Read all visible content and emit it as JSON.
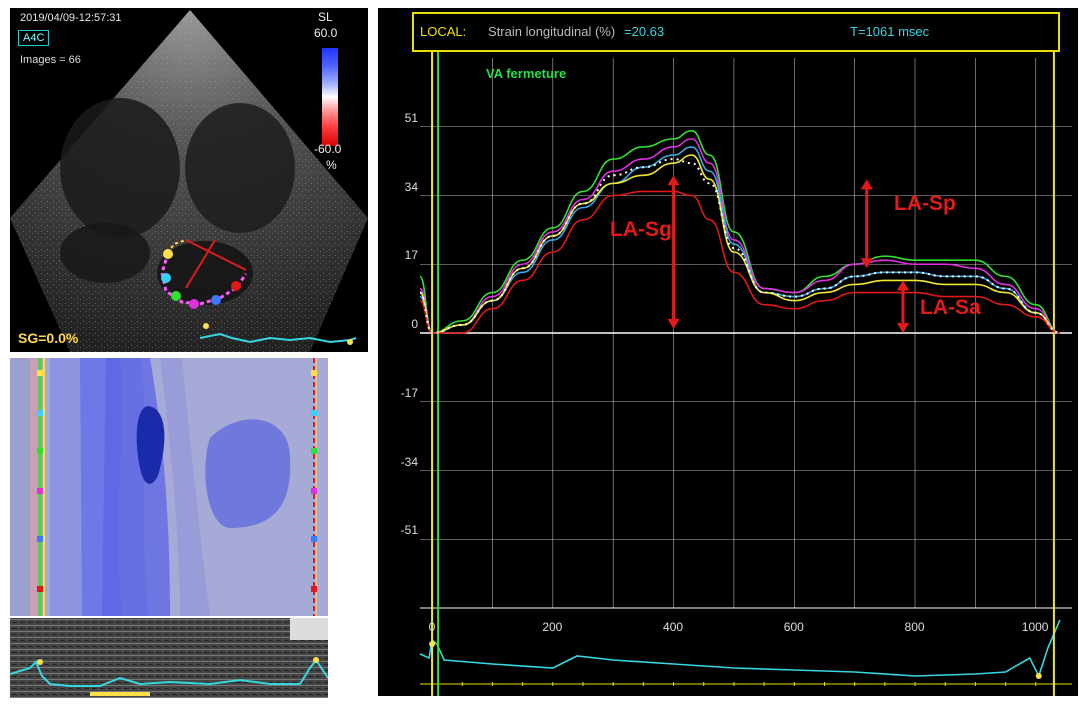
{
  "echo": {
    "timestamp": "2019/04/09-12:57:31",
    "view": "A4C",
    "images": "Images = 66",
    "scale_title": "SL",
    "scale_max": "60.0",
    "scale_min": "-60.0",
    "scale_unit": "%",
    "sg": "SG=0.0%"
  },
  "header": {
    "local": "LOCAL:",
    "strain_label": "Strain longitudinal (%)",
    "strain_value": "=20.63",
    "time": "T=1061 msec"
  },
  "markers": {
    "va_label": "VA fermeture"
  },
  "annotations": {
    "sg": "LA-Sg",
    "sp": "LA-Sp",
    "sa": "LA-Sa"
  },
  "colors": {
    "background": "#000000",
    "grid": "#ffffff",
    "header_border": "#e8e000",
    "va_marker": "#22e04a",
    "annotation": "#e31a1a",
    "ecg": "#36d7e0"
  },
  "chart_data": {
    "type": "line",
    "xlim": [
      -20,
      1060
    ],
    "ylim": [
      -68,
      68
    ],
    "y_ticks": [
      51,
      34,
      17,
      0,
      -17,
      -34,
      -51
    ],
    "x_ticks": [
      0,
      200,
      400,
      600,
      800,
      1000
    ],
    "x": [
      -60,
      0,
      50,
      100,
      150,
      200,
      250,
      300,
      350,
      400,
      430,
      460,
      500,
      550,
      600,
      650,
      700,
      750,
      800,
      850,
      900,
      950,
      1000,
      1040
    ],
    "series": [
      {
        "color": "#32e032",
        "values": [
          14,
          0,
          3,
          10,
          18,
          26,
          35,
          43,
          46,
          48,
          50,
          44,
          25,
          11,
          10,
          14,
          17,
          19,
          18,
          18,
          18,
          14,
          7,
          0
        ]
      },
      {
        "color": "#e030e0",
        "values": [
          11,
          0,
          2,
          9,
          17,
          25,
          33,
          40,
          43,
          46,
          48,
          42,
          23,
          11,
          10,
          13,
          17,
          18,
          17,
          17,
          16,
          12,
          6,
          0
        ]
      },
      {
        "color": "#3aa8e8",
        "values": [
          9,
          0,
          2,
          8,
          15,
          23,
          31,
          37,
          41,
          44,
          46,
          40,
          22,
          10,
          9,
          11,
          14,
          15,
          15,
          14,
          14,
          11,
          5,
          0
        ]
      },
      {
        "color": "#f0e830",
        "values": [
          10,
          0,
          2,
          8,
          16,
          24,
          32,
          37,
          39,
          42,
          44,
          38,
          20,
          10,
          8,
          10,
          12,
          13,
          13,
          12,
          12,
          10,
          5,
          0
        ]
      },
      {
        "color": "#e01818",
        "values": [
          8,
          0,
          0,
          6,
          13,
          20,
          28,
          34,
          35,
          35,
          34,
          28,
          15,
          7,
          6,
          8,
          10,
          10,
          10,
          9,
          9,
          7,
          4,
          0
        ]
      },
      {
        "color": "#ffffff",
        "dashed": true,
        "values": [
          10,
          0,
          2,
          8,
          16,
          24,
          32,
          39,
          41,
          43,
          42,
          37,
          21,
          10,
          9,
          11,
          14,
          15,
          15,
          14,
          14,
          11,
          5,
          0
        ]
      }
    ],
    "vlines": [
      {
        "x": 0,
        "color": "#f0e830"
      },
      {
        "x": 10,
        "color": "#32e032"
      },
      {
        "x": 1030,
        "color": "#f0e830"
      }
    ]
  }
}
